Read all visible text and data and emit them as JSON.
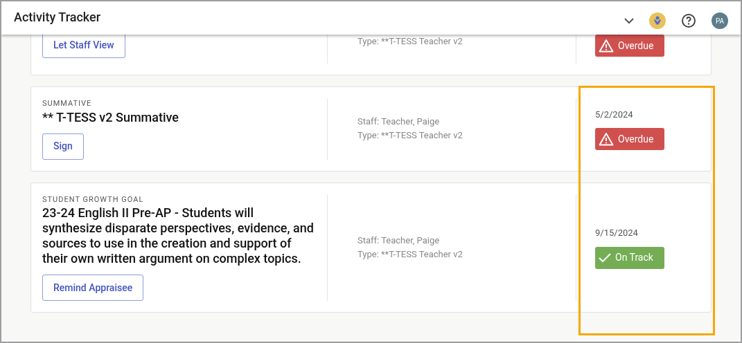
{
  "header": {
    "title": "Activity Tracker",
    "avatar": "PA"
  },
  "activities": [
    {
      "action": "Let Staff View",
      "type": "Type: **T-TESS Teacher v2",
      "status": {
        "kind": "overdue",
        "label": "Overdue"
      }
    },
    {
      "category": "SUMMATIVE",
      "title": "** T-TESS v2 Summative",
      "action": "Sign",
      "staff": "Staff: Teacher, Paige",
      "type": "Type: **T-TESS Teacher v2",
      "date": "5/2/2024",
      "status": {
        "kind": "overdue",
        "label": "Overdue"
      }
    },
    {
      "category": "STUDENT GROWTH GOAL",
      "title": "23-24 English II Pre-AP - Students will synthesize disparate perspectives, evidence, and sources to use in the creation and support of their own written argument on complex topics.",
      "action": "Remind Appraisee",
      "staff": "Staff: Teacher, Paige",
      "type": "Type: **T-TESS Teacher v2",
      "date": "9/15/2024",
      "status": {
        "kind": "ontrack",
        "label": "On Track"
      }
    }
  ]
}
